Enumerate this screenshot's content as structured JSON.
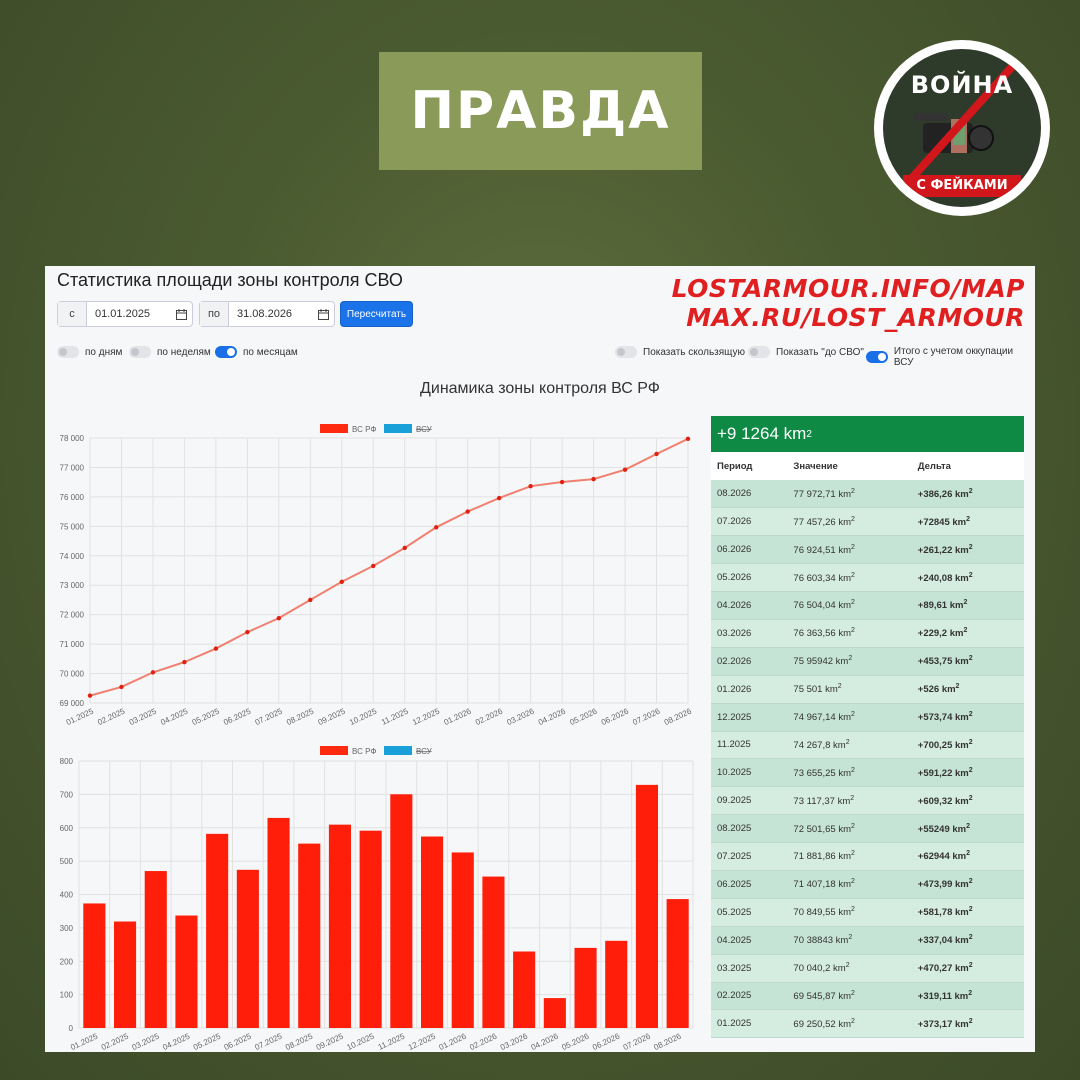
{
  "banner": {
    "text": "ПРАВДА"
  },
  "logo": {
    "top_text": "ВОЙНА",
    "bottom_text": "С ФЕЙКАМИ",
    "badge": "ON",
    "colors": {
      "red": "#d2171c",
      "dark": "#2e3a2a"
    }
  },
  "panel": {
    "title": "Статистика площади зоны контроля СВО",
    "urls": [
      "LOSTARMOUR.INFO/MAP",
      "MAX.RU/LOST_ARMOUR"
    ],
    "from_prefix": "с",
    "from_value": "01.01.2025",
    "to_prefix": "по",
    "to_value": "31.08.2026",
    "recalc_label": "Пересчитать",
    "toggles_left": [
      {
        "label": "по дням",
        "on": false
      },
      {
        "label": "по неделям",
        "on": false
      },
      {
        "label": "по месяцам",
        "on": true
      }
    ],
    "toggles_right": [
      {
        "label": "Показать скользящую",
        "on": false
      },
      {
        "label": "Показать \"до СВО\"",
        "on": false
      },
      {
        "label": "Итого с учетом оккупации ВСУ",
        "on": true
      }
    ],
    "chart_title": "Динамика зоны контроля ВС РФ"
  },
  "summary": {
    "value": "+9 1264",
    "unit": "km",
    "unit_sup": "2"
  },
  "table": {
    "headers": [
      "Период",
      "Значение",
      "Дельта"
    ],
    "unit": "km",
    "rows": [
      {
        "period": "08.2026",
        "value": "77 972,71",
        "delta": "+386,26"
      },
      {
        "period": "07.2026",
        "value": "77 457,26",
        "delta": "+72845"
      },
      {
        "period": "06.2026",
        "value": "76 924,51",
        "delta": "+261,22"
      },
      {
        "period": "05.2026",
        "value": "76 603,34",
        "delta": "+240,08"
      },
      {
        "period": "04.2026",
        "value": "76 504,04",
        "delta": "+89,61"
      },
      {
        "period": "03.2026",
        "value": "76 363,56",
        "delta": "+229,2"
      },
      {
        "period": "02.2026",
        "value": "75 95942",
        "delta": "+453,75"
      },
      {
        "period": "01.2026",
        "value": "75 501",
        "delta": "+526"
      },
      {
        "period": "12.2025",
        "value": "74 967,14",
        "delta": "+573,74"
      },
      {
        "period": "11.2025",
        "value": "74 267,8",
        "delta": "+700,25"
      },
      {
        "period": "10.2025",
        "value": "73 655,25",
        "delta": "+591,22"
      },
      {
        "period": "09.2025",
        "value": "73 117,37",
        "delta": "+609,32"
      },
      {
        "period": "08.2025",
        "value": "72 501,65",
        "delta": "+55249"
      },
      {
        "period": "07.2025",
        "value": "71 881,86",
        "delta": "+62944"
      },
      {
        "period": "06.2025",
        "value": "71 407,18",
        "delta": "+473,99"
      },
      {
        "period": "05.2025",
        "value": "70 849,55",
        "delta": "+581,78"
      },
      {
        "period": "04.2025",
        "value": "70 38843",
        "delta": "+337,04"
      },
      {
        "period": "03.2025",
        "value": "70 040,2",
        "delta": "+470,27"
      },
      {
        "period": "02.2025",
        "value": "69 545,87",
        "delta": "+319,11"
      },
      {
        "period": "01.2025",
        "value": "69 250,52",
        "delta": "+373,17"
      }
    ]
  },
  "chart_data": [
    {
      "type": "line",
      "legend": [
        "ВС РФ",
        "ВСУ"
      ],
      "legend_colors": [
        "#ff2a10",
        "#1aa0d8"
      ],
      "line_color": "#f08070",
      "point_color": "#e02010",
      "categories": [
        "01.2025",
        "02.2025",
        "03.2025",
        "04.2025",
        "05.2025",
        "06.2025",
        "07.2025",
        "08.2025",
        "09.2025",
        "10.2025",
        "11.2025",
        "12.2025",
        "01.2026",
        "02.2026",
        "03.2026",
        "04.2026",
        "05.2026",
        "06.2026",
        "07.2026",
        "08.2026"
      ],
      "values": [
        69250.52,
        69545.87,
        70040.2,
        70388.43,
        70849.55,
        71407.18,
        71881.86,
        72501.65,
        73117.37,
        73655.25,
        74267.8,
        74967.14,
        75501,
        75959.42,
        76363.56,
        76504.04,
        76603.34,
        76924.51,
        77457.26,
        77972.71
      ],
      "ylim": [
        69000,
        78000
      ],
      "yticks": [
        "69 000",
        "70 000",
        "71 000",
        "72 000",
        "73 000",
        "74 000",
        "75 000",
        "76 000",
        "77 000",
        "78 000"
      ],
      "grid": true,
      "legend_position": "top"
    },
    {
      "type": "bar",
      "legend": [
        "ВС РФ",
        "ВСУ"
      ],
      "legend_colors": [
        "#ff2a10",
        "#1aa0d8"
      ],
      "bar_color": "#ff1e0a",
      "categories": [
        "01.2025",
        "02.2025",
        "03.2025",
        "04.2025",
        "05.2025",
        "06.2025",
        "07.2025",
        "08.2025",
        "09.2025",
        "10.2025",
        "11.2025",
        "12.2025",
        "01.2026",
        "02.2026",
        "03.2026",
        "04.2026",
        "05.2026",
        "06.2026",
        "07.2026",
        "08.2026"
      ],
      "values": [
        373.17,
        319.11,
        470.27,
        337.04,
        581.78,
        473.99,
        629.44,
        552.49,
        609.32,
        591.22,
        700.25,
        573.74,
        526,
        453.75,
        229.2,
        89.61,
        240.08,
        261.22,
        728.45,
        386.26
      ],
      "ylim": [
        0,
        800
      ],
      "yticks": [
        "0",
        "100",
        "200",
        "300",
        "400",
        "500",
        "600",
        "700",
        "800"
      ],
      "grid": true,
      "legend_position": "top"
    }
  ]
}
